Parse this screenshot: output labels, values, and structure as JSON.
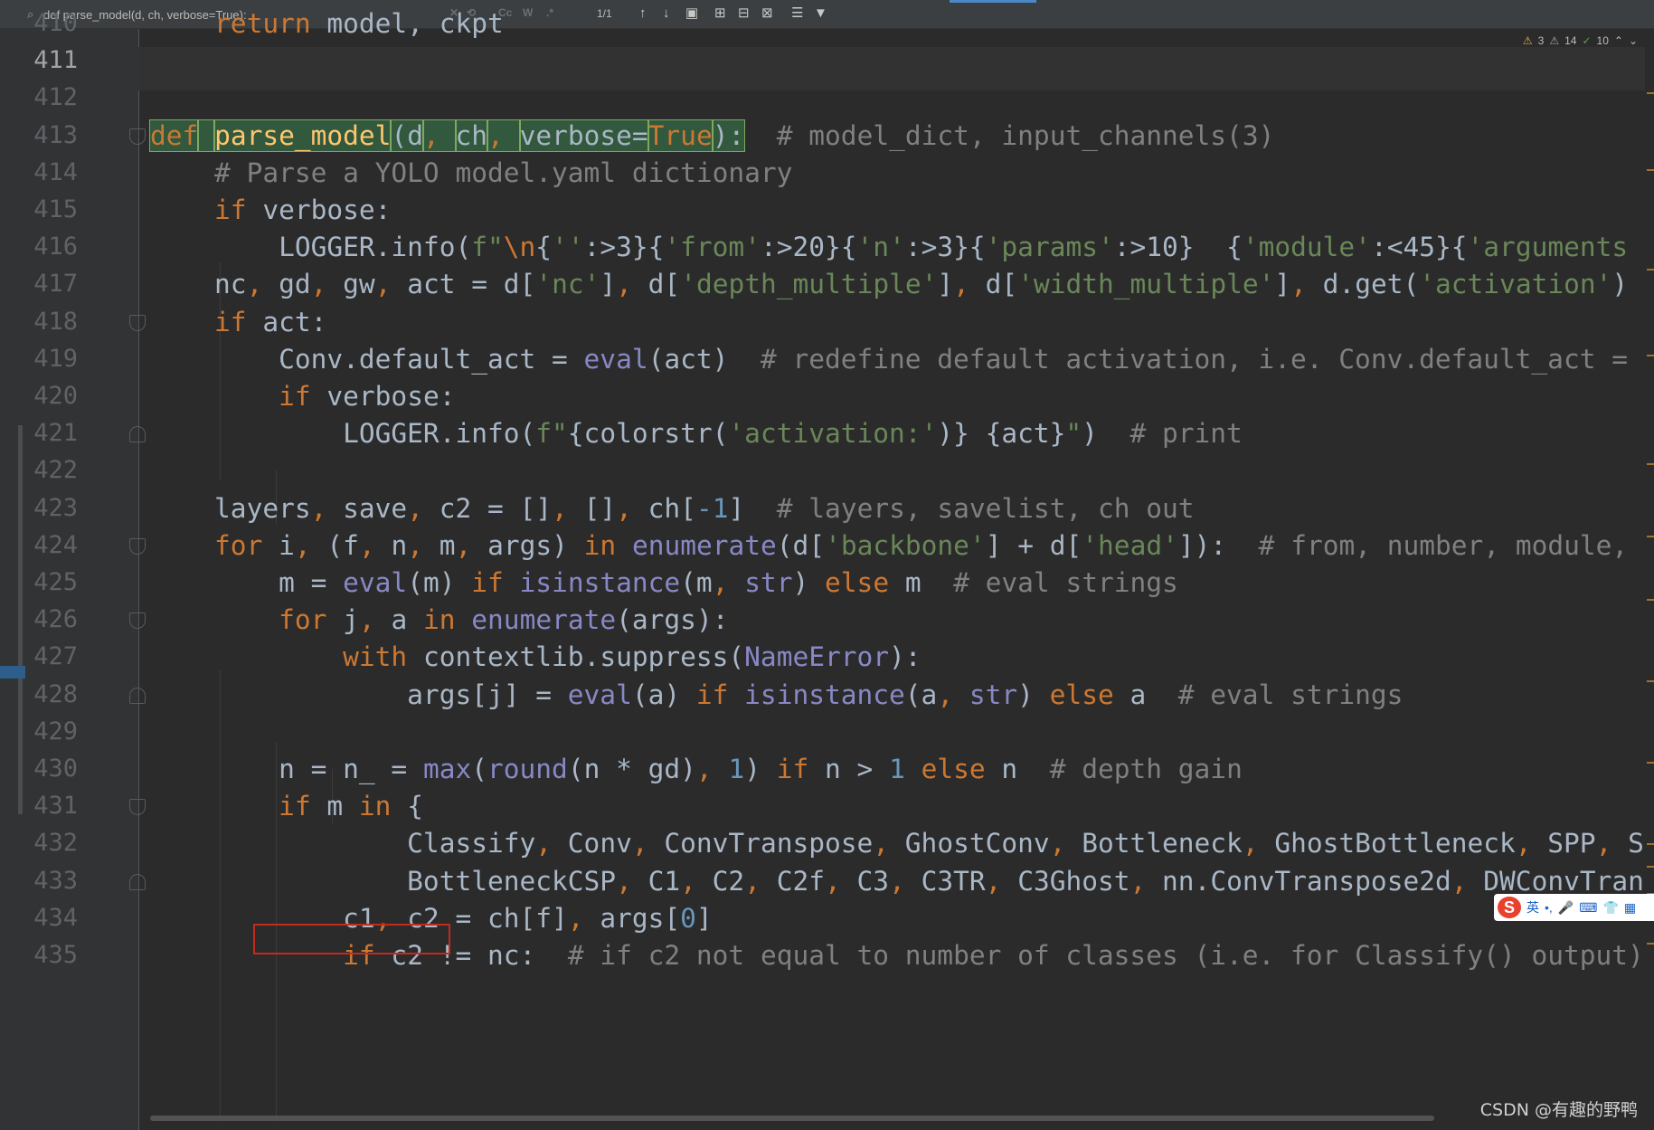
{
  "find_bar": {
    "query": "def parse_model(d, ch, verbose=True):",
    "match_case_label": "Cc",
    "words_label": "W",
    "regex_label": ".*",
    "match_count": "1/1"
  },
  "inspections": {
    "warnings": "3",
    "weak_warnings": "14",
    "ok": "10"
  },
  "editor": {
    "current_line": "411",
    "lines": [
      {
        "n": "410",
        "tokens": [
          {
            "t": "    "
          },
          {
            "t": "return",
            "c": "kw"
          },
          {
            "t": " model, ckpt"
          }
        ]
      },
      {
        "n": "411",
        "tokens": []
      },
      {
        "n": "412",
        "tokens": []
      },
      {
        "n": "413",
        "tokens": [
          {
            "t": "def",
            "c": "kw hl"
          },
          {
            "t": " ",
            "c": "hl"
          },
          {
            "t": "parse_model",
            "c": "fn hl"
          },
          {
            "t": "(d",
            "c": "hl"
          },
          {
            "t": ", ",
            "c": "kw hl"
          },
          {
            "t": "ch",
            "c": "hl"
          },
          {
            "t": ", ",
            "c": "kw hl"
          },
          {
            "t": "verbose=",
            "c": "hl"
          },
          {
            "t": "True",
            "c": "kw hl"
          },
          {
            "t": "):",
            "c": "hl"
          },
          {
            "t": "  "
          },
          {
            "t": "# model_dict, input_channels(3)",
            "c": "cm"
          }
        ]
      },
      {
        "n": "414",
        "tokens": [
          {
            "t": "    "
          },
          {
            "t": "# Parse a YOLO model.yaml dictionary",
            "c": "cm"
          }
        ]
      },
      {
        "n": "415",
        "tokens": [
          {
            "t": "    "
          },
          {
            "t": "if",
            "c": "kw"
          },
          {
            "t": " verbose:"
          }
        ]
      },
      {
        "n": "416",
        "tokens": [
          {
            "t": "        LOGGER.info("
          },
          {
            "t": "f\"",
            "c": "str"
          },
          {
            "t": "\\n",
            "c": "kw"
          },
          {
            "t": "{"
          },
          {
            "t": "''",
            "c": "str"
          },
          {
            "t": ":>3}{"
          },
          {
            "t": "'from'",
            "c": "str"
          },
          {
            "t": ":>20}{"
          },
          {
            "t": "'n'",
            "c": "str"
          },
          {
            "t": ":>3}{"
          },
          {
            "t": "'params'",
            "c": "str"
          },
          {
            "t": ":>10}"
          },
          {
            "t": "  ",
            "c": "str"
          },
          {
            "t": "{"
          },
          {
            "t": "'module'",
            "c": "str"
          },
          {
            "t": ":<45}{"
          },
          {
            "t": "'arguments",
            "c": "str"
          }
        ]
      },
      {
        "n": "417",
        "tokens": [
          {
            "t": "    nc"
          },
          {
            "t": ", ",
            "c": "kw"
          },
          {
            "t": "gd"
          },
          {
            "t": ", ",
            "c": "kw"
          },
          {
            "t": "gw"
          },
          {
            "t": ", ",
            "c": "kw"
          },
          {
            "t": "act = d["
          },
          {
            "t": "'nc'",
            "c": "str"
          },
          {
            "t": "]"
          },
          {
            "t": ", ",
            "c": "kw"
          },
          {
            "t": "d["
          },
          {
            "t": "'depth_multiple'",
            "c": "str"
          },
          {
            "t": "]"
          },
          {
            "t": ", ",
            "c": "kw"
          },
          {
            "t": "d["
          },
          {
            "t": "'width_multiple'",
            "c": "str"
          },
          {
            "t": "]"
          },
          {
            "t": ", ",
            "c": "kw"
          },
          {
            "t": "d.get("
          },
          {
            "t": "'activation'",
            "c": "str"
          },
          {
            "t": ")"
          }
        ]
      },
      {
        "n": "418",
        "tokens": [
          {
            "t": "    "
          },
          {
            "t": "if",
            "c": "kw"
          },
          {
            "t": " act:"
          }
        ]
      },
      {
        "n": "419",
        "tokens": [
          {
            "t": "        Conv.default_act = "
          },
          {
            "t": "eval",
            "c": "bi"
          },
          {
            "t": "(act)  "
          },
          {
            "t": "# redefine default activation, i.e. Conv.default_act =",
            "c": "cm"
          }
        ]
      },
      {
        "n": "420",
        "tokens": [
          {
            "t": "        "
          },
          {
            "t": "if",
            "c": "kw"
          },
          {
            "t": " verbose:"
          }
        ]
      },
      {
        "n": "421",
        "tokens": [
          {
            "t": "            LOGGER.info("
          },
          {
            "t": "f\"",
            "c": "str"
          },
          {
            "t": "{colorstr("
          },
          {
            "t": "'activation:'",
            "c": "str"
          },
          {
            "t": ")}"
          },
          {
            "t": " ",
            "c": "str"
          },
          {
            "t": "{act}"
          },
          {
            "t": "\"",
            "c": "str"
          },
          {
            "t": ")  "
          },
          {
            "t": "# print",
            "c": "cm"
          }
        ]
      },
      {
        "n": "422",
        "tokens": []
      },
      {
        "n": "423",
        "tokens": [
          {
            "t": "    layers"
          },
          {
            "t": ", ",
            "c": "kw"
          },
          {
            "t": "save"
          },
          {
            "t": ", ",
            "c": "kw"
          },
          {
            "t": "c2 = []"
          },
          {
            "t": ", ",
            "c": "kw"
          },
          {
            "t": "[]"
          },
          {
            "t": ", ",
            "c": "kw"
          },
          {
            "t": "ch["
          },
          {
            "t": "-1",
            "c": "num"
          },
          {
            "t": "]  "
          },
          {
            "t": "# layers, savelist, ch out",
            "c": "cm"
          }
        ]
      },
      {
        "n": "424",
        "tokens": [
          {
            "t": "    "
          },
          {
            "t": "for",
            "c": "kw"
          },
          {
            "t": " i"
          },
          {
            "t": ", ",
            "c": "kw"
          },
          {
            "t": "(f"
          },
          {
            "t": ", ",
            "c": "kw"
          },
          {
            "t": "n"
          },
          {
            "t": ", ",
            "c": "kw"
          },
          {
            "t": "m"
          },
          {
            "t": ", ",
            "c": "kw"
          },
          {
            "t": "args) "
          },
          {
            "t": "in",
            "c": "kw"
          },
          {
            "t": " "
          },
          {
            "t": "enumerate",
            "c": "bi"
          },
          {
            "t": "(d["
          },
          {
            "t": "'backbone'",
            "c": "str"
          },
          {
            "t": "] + d["
          },
          {
            "t": "'head'",
            "c": "str"
          },
          {
            "t": "]):  "
          },
          {
            "t": "# from, number, module,",
            "c": "cm"
          }
        ]
      },
      {
        "n": "425",
        "tokens": [
          {
            "t": "        m = "
          },
          {
            "t": "eval",
            "c": "bi"
          },
          {
            "t": "(m) "
          },
          {
            "t": "if",
            "c": "kw"
          },
          {
            "t": " "
          },
          {
            "t": "isinstance",
            "c": "bi"
          },
          {
            "t": "(m"
          },
          {
            "t": ", ",
            "c": "kw"
          },
          {
            "t": "str",
            "c": "bi"
          },
          {
            "t": ") "
          },
          {
            "t": "else",
            "c": "kw"
          },
          {
            "t": " m  "
          },
          {
            "t": "# eval strings",
            "c": "cm"
          }
        ]
      },
      {
        "n": "426",
        "tokens": [
          {
            "t": "        "
          },
          {
            "t": "for",
            "c": "kw"
          },
          {
            "t": " j"
          },
          {
            "t": ", ",
            "c": "kw"
          },
          {
            "t": "a "
          },
          {
            "t": "in",
            "c": "kw"
          },
          {
            "t": " "
          },
          {
            "t": "enumerate",
            "c": "bi"
          },
          {
            "t": "(args):"
          }
        ]
      },
      {
        "n": "427",
        "tokens": [
          {
            "t": "            "
          },
          {
            "t": "with",
            "c": "kw"
          },
          {
            "t": " contextlib.suppress("
          },
          {
            "t": "NameError",
            "c": "bi"
          },
          {
            "t": "):"
          }
        ]
      },
      {
        "n": "428",
        "tokens": [
          {
            "t": "                args[j] = "
          },
          {
            "t": "eval",
            "c": "bi"
          },
          {
            "t": "(a) "
          },
          {
            "t": "if",
            "c": "kw"
          },
          {
            "t": " "
          },
          {
            "t": "isinstance",
            "c": "bi"
          },
          {
            "t": "(a"
          },
          {
            "t": ", ",
            "c": "kw"
          },
          {
            "t": "str",
            "c": "bi"
          },
          {
            "t": ") "
          },
          {
            "t": "else",
            "c": "kw"
          },
          {
            "t": " a  "
          },
          {
            "t": "# eval strings",
            "c": "cm"
          }
        ]
      },
      {
        "n": "429",
        "tokens": []
      },
      {
        "n": "430",
        "tokens": [
          {
            "t": "        n = n_ = "
          },
          {
            "t": "max",
            "c": "bi"
          },
          {
            "t": "("
          },
          {
            "t": "round",
            "c": "bi"
          },
          {
            "t": "(n * gd)"
          },
          {
            "t": ", ",
            "c": "kw"
          },
          {
            "t": "1",
            "c": "num"
          },
          {
            "t": ") "
          },
          {
            "t": "if",
            "c": "kw"
          },
          {
            "t": " n > "
          },
          {
            "t": "1",
            "c": "num"
          },
          {
            "t": " "
          },
          {
            "t": "else",
            "c": "kw"
          },
          {
            "t": " n  "
          },
          {
            "t": "# depth gain",
            "c": "cm"
          }
        ]
      },
      {
        "n": "431",
        "tokens": [
          {
            "t": "        "
          },
          {
            "t": "if",
            "c": "kw"
          },
          {
            "t": " m "
          },
          {
            "t": "in",
            "c": "kw"
          },
          {
            "t": " {"
          }
        ]
      },
      {
        "n": "432",
        "tokens": [
          {
            "t": "                Classify"
          },
          {
            "t": ", ",
            "c": "kw"
          },
          {
            "t": "Conv"
          },
          {
            "t": ", ",
            "c": "kw"
          },
          {
            "t": "ConvTranspose"
          },
          {
            "t": ", ",
            "c": "kw"
          },
          {
            "t": "GhostConv"
          },
          {
            "t": ", ",
            "c": "kw"
          },
          {
            "t": "Bottleneck"
          },
          {
            "t": ", ",
            "c": "kw"
          },
          {
            "t": "GhostBottleneck"
          },
          {
            "t": ", ",
            "c": "kw"
          },
          {
            "t": "SPP"
          },
          {
            "t": ", ",
            "c": "kw"
          },
          {
            "t": "S"
          }
        ]
      },
      {
        "n": "433",
        "tokens": [
          {
            "t": "                BottleneckCSP"
          },
          {
            "t": ", ",
            "c": "kw"
          },
          {
            "t": "C1"
          },
          {
            "t": ", ",
            "c": "kw"
          },
          {
            "t": "C2"
          },
          {
            "t": ", ",
            "c": "kw"
          },
          {
            "t": "C2f"
          },
          {
            "t": ", ",
            "c": "kw"
          },
          {
            "t": "C3"
          },
          {
            "t": ", ",
            "c": "kw"
          },
          {
            "t": "C3TR"
          },
          {
            "t": ", ",
            "c": "kw"
          },
          {
            "t": "C3Ghost"
          },
          {
            "t": ", ",
            "c": "kw"
          },
          {
            "t": "nn.ConvTranspose2d"
          },
          {
            "t": ", ",
            "c": "kw"
          },
          {
            "t": "DWConvTran"
          }
        ]
      },
      {
        "n": "434",
        "tokens": [
          {
            "t": "            c1"
          },
          {
            "t": ", ",
            "c": "kw"
          },
          {
            "t": "c2 = ch[f]"
          },
          {
            "t": ", ",
            "c": "kw"
          },
          {
            "t": "args["
          },
          {
            "t": "0",
            "c": "num"
          },
          {
            "t": "]"
          }
        ]
      },
      {
        "n": "435",
        "tokens": [
          {
            "t": "            "
          },
          {
            "t": "if",
            "c": "kw"
          },
          {
            "t": " c2 != nc:  "
          },
          {
            "t": "# if c2 not equal to number of classes (i.e. for Classify() output)",
            "c": "cm"
          }
        ]
      }
    ]
  },
  "ime": {
    "logo": "S",
    "lang": "英",
    "punct": "•,"
  },
  "watermark": "CSDN @有趣的野鸭",
  "colors": {
    "keyword": "#cc7832",
    "function": "#ffc66d",
    "string": "#6a8759",
    "comment": "#808080",
    "number": "#6897bb",
    "builtin": "#8888c6",
    "annotation_box": "#c42b1c"
  }
}
